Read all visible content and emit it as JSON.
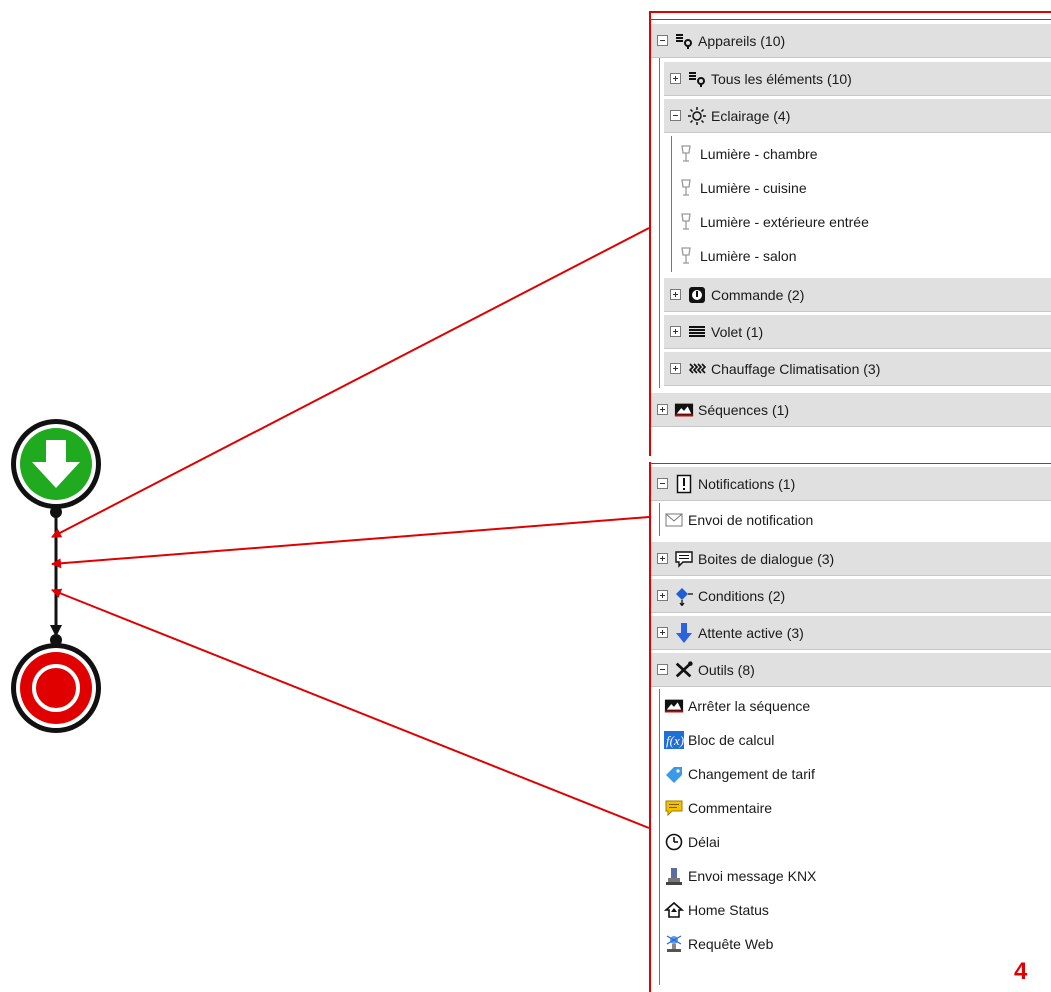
{
  "top_panel": {
    "appareils": {
      "label": "Appareils (10)"
    },
    "tous": {
      "label": "Tous les éléments (10)"
    },
    "eclairage": {
      "label": "Eclairage (4)",
      "items": [
        "Lumière - chambre",
        "Lumière - cuisine",
        "Lumière - extérieure entrée",
        "Lumière - salon"
      ]
    },
    "commande": {
      "label": "Commande (2)"
    },
    "volet": {
      "label": "Volet (1)"
    },
    "chauffage": {
      "label": "Chauffage Climatisation (3)"
    },
    "sequences": {
      "label": "Séquences (1)"
    }
  },
  "bottom_panel": {
    "notifications": {
      "label": "Notifications (1)",
      "items": [
        "Envoi de notification"
      ]
    },
    "boites": {
      "label": "Boites de dialogue (3)"
    },
    "conditions": {
      "label": "Conditions (2)"
    },
    "attente": {
      "label": "Attente active (3)"
    },
    "outils": {
      "label": "Outils (8)",
      "items": [
        "Arrêter la séquence",
        "Bloc de calcul",
        "Changement de tarif",
        "Commentaire",
        "Délai",
        "Envoi message KNX",
        "Home Status",
        "Requête Web"
      ]
    }
  },
  "page_number": "4",
  "colors": {
    "arrow": "#e00000",
    "start": "#1faa1f",
    "stop": "#e00000",
    "row_bg": "#e0e0e0"
  },
  "icons": {
    "appareils": "devices-icon",
    "eclairage": "bulb-icon",
    "light": "lamp-icon",
    "commande": "command-icon",
    "volet": "shutter-icon",
    "chauffage": "heating-icon",
    "sequences": "sequence-icon",
    "notifications": "notification-icon",
    "boites": "dialog-icon",
    "conditions": "condition-icon",
    "attente": "wait-icon",
    "outils": "tools-icon"
  }
}
